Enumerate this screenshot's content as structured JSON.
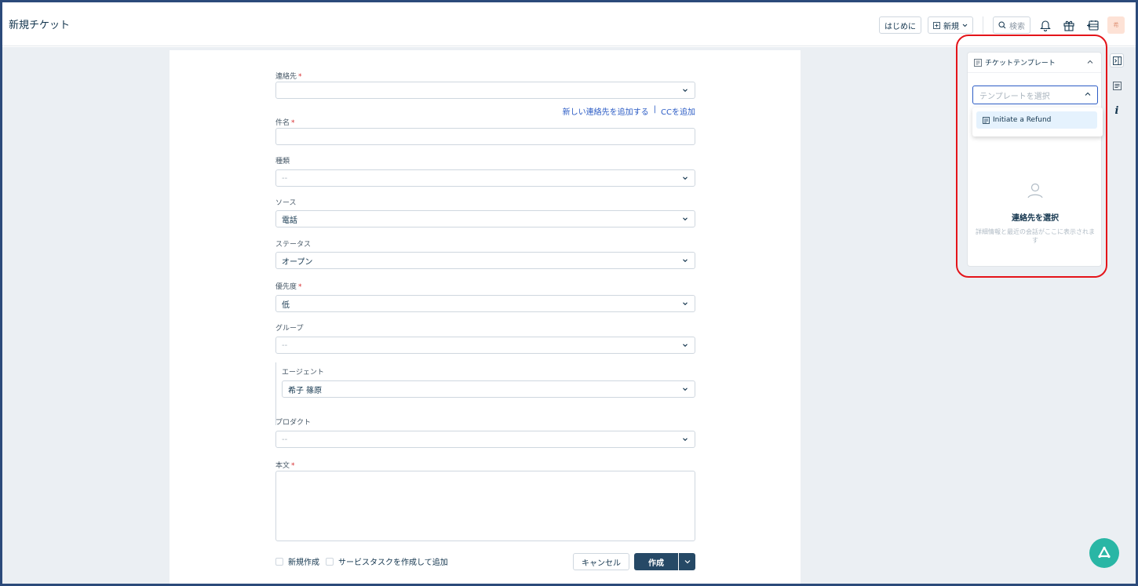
{
  "header": {
    "title": "新規チケット",
    "getting_started": "はじめに",
    "new_label": "新規",
    "search_placeholder": "検索",
    "avatar_initial": "希"
  },
  "form": {
    "contact_label": "連絡先",
    "add_contact_link": "新しい連絡先を追加する",
    "link_separator": "|",
    "add_cc_link": "CCを追加",
    "subject_label": "件名",
    "type_label": "種類",
    "type_value": "--",
    "source_label": "ソース",
    "source_value": "電話",
    "status_label": "ステータス",
    "status_value": "オープン",
    "priority_label": "優先度",
    "priority_value": "低",
    "group_label": "グループ",
    "group_value": "--",
    "agent_label": "エージェント",
    "agent_value": "希子 篠原",
    "product_label": "プロダクト",
    "product_value": "--",
    "body_label": "本文",
    "required_mark": "*",
    "create_new_label": "新規作成",
    "create_service_task_label": "サービスタスクを作成して追加",
    "cancel_label": "キャンセル",
    "create_label": "作成"
  },
  "template_panel": {
    "title": "チケットテンプレート",
    "select_placeholder": "テンプレートを選択",
    "options": [
      "Initiate a Refund"
    ],
    "empty_title": "連絡先を選択",
    "empty_subtitle": "詳細情報と最近の会話がここに表示されます"
  },
  "colors": {
    "primary_button": "#264966",
    "link": "#2c5cc5",
    "required": "#d72d30",
    "highlight": "#e4141a",
    "fab": "#29b6a5"
  }
}
